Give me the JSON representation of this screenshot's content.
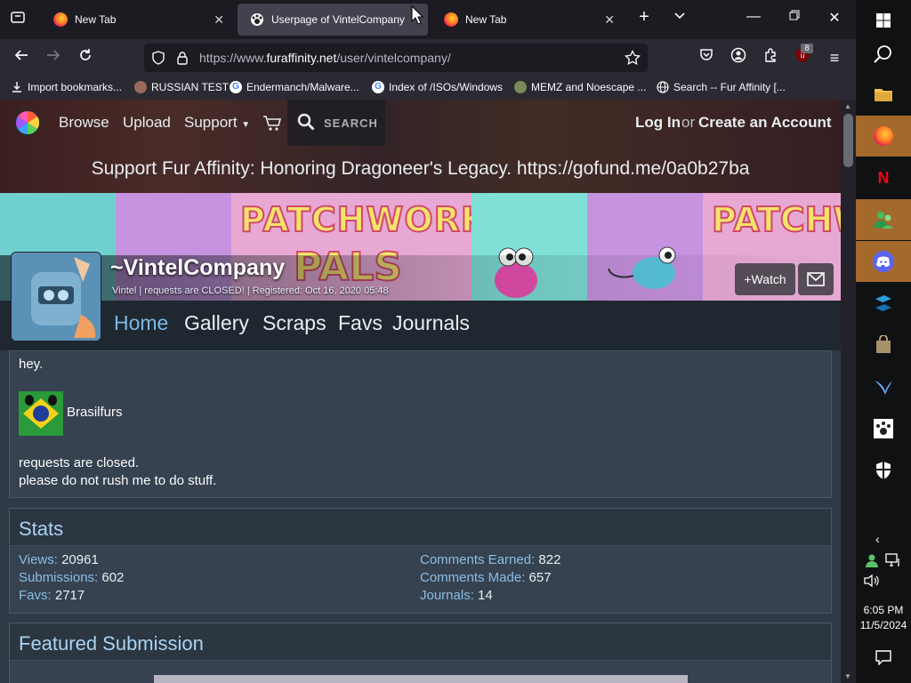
{
  "tabs": [
    {
      "title": "New Tab"
    },
    {
      "title": "Userpage of VintelCompany"
    },
    {
      "title": "New Tab"
    }
  ],
  "address": {
    "prefix": "https://www.",
    "host": "furaffinity.net",
    "path": "/user/vintelcompany/"
  },
  "extensions_badge": "8",
  "bookmarks": [
    "Import bookmarks...",
    "RUSSIAN TEST",
    "Endermanch/Malware...",
    "Index of /ISOs/Windows",
    "MEMZ and Noescape ...",
    "Search -- Fur Affinity [..."
  ],
  "site_nav": {
    "browse": "Browse",
    "upload": "Upload",
    "support": "Support",
    "search": "SEARCH",
    "login": "Log In",
    "or": "or",
    "create": "Create an Account"
  },
  "banner_message": "Support Fur Affinity: Honoring Dragoneer's Legacy. https://gofund.me/0a0b27ba",
  "banner_art_text": [
    "PATCHWORK",
    "PALS",
    "PATCHW"
  ],
  "user": {
    "name": "~VintelCompany",
    "subtitle": "Vintel | requests are CLOSED! | Registered: Oct 16, 2020 05:48",
    "watch": "+Watch"
  },
  "user_tabs": [
    "Home",
    "Gallery",
    "Scraps",
    "Favs",
    "Journals"
  ],
  "profile": {
    "greeting": "hey.",
    "group": "Brasilfurs",
    "line1": "requests are closed.",
    "line2": "please do not rush me to do stuff."
  },
  "stats": {
    "title": "Stats",
    "left": [
      {
        "k": "Views:",
        "v": "20961"
      },
      {
        "k": "Submissions:",
        "v": "602"
      },
      {
        "k": "Favs:",
        "v": "2717"
      }
    ],
    "right": [
      {
        "k": "Comments Earned:",
        "v": "822"
      },
      {
        "k": "Comments Made:",
        "v": "657"
      },
      {
        "k": "Journals:",
        "v": "14"
      }
    ]
  },
  "featured": {
    "title": "Featured Submission"
  },
  "clock": {
    "time": "6:05 PM",
    "date": "11/5/2024"
  },
  "colors": {
    "accent": "#7cb8e6",
    "stat_key": "#8bbde6",
    "box_bg": "#36424f",
    "taskbar_running": "#a36a2c"
  }
}
